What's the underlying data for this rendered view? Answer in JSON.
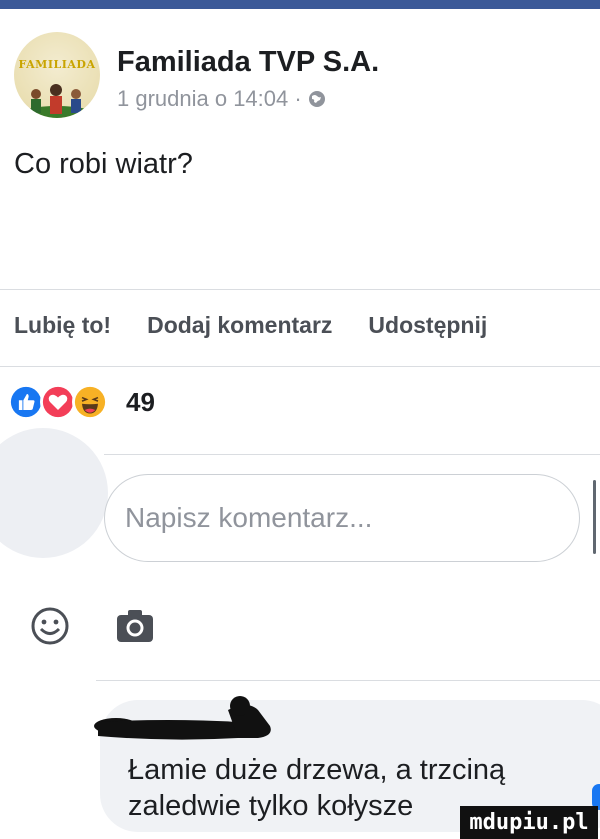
{
  "post": {
    "page_name": "Familiada TVP S.A.",
    "avatar_text": "FAMILIADA",
    "timestamp": "1 grudnia o 14:04 ·",
    "body": "Co robi wiatr?"
  },
  "actions": {
    "like": "Lubię to!",
    "comment": "Dodaj komentarz",
    "share": "Udostępnij"
  },
  "reactions": {
    "types": [
      "like-icon",
      "love-icon",
      "haha-icon"
    ],
    "count": "49"
  },
  "comment_box": {
    "placeholder": "Napisz komentarz..."
  },
  "comment": {
    "line1": "Łamie duże drzewa, a trzciną",
    "line2": "zaledwie tylko kołysze"
  },
  "watermark": "mdupiu.pl",
  "colors": {
    "brand": "#3b5998",
    "like_blue": "#1877f2",
    "love_red": "#f33e58",
    "haha_yellow": "#f7b125",
    "muted": "#90949c"
  }
}
